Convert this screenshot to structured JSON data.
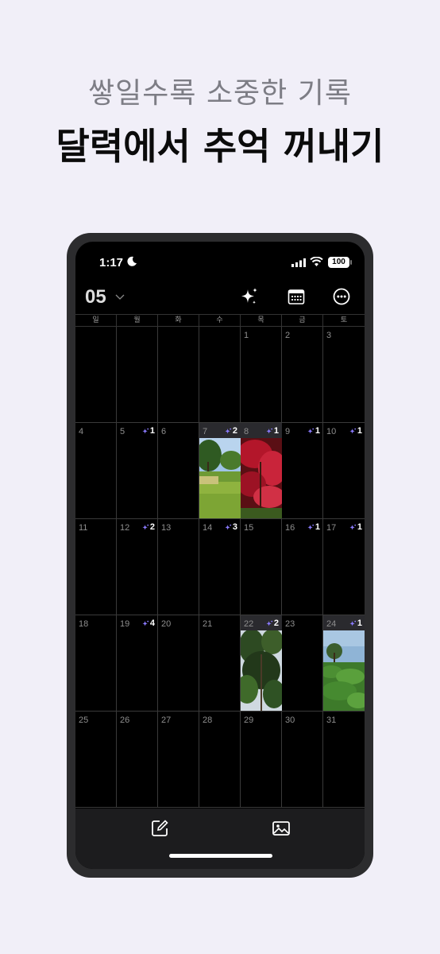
{
  "promo": {
    "subtitle": "쌓일수록 소중한 기록",
    "title": "달력에서 추억 꺼내기"
  },
  "status_bar": {
    "time": "1:17",
    "battery": "100"
  },
  "header": {
    "month": "05",
    "icons": [
      "sparkle-icon",
      "calendar-icon",
      "more-icon"
    ]
  },
  "weekdays": [
    "일",
    "월",
    "화",
    "수",
    "목",
    "금",
    "토"
  ],
  "accent_color": "#8b7bff",
  "weeks": [
    [
      {
        "day": ""
      },
      {
        "day": ""
      },
      {
        "day": ""
      },
      {
        "day": ""
      },
      {
        "day": "1"
      },
      {
        "day": "2"
      },
      {
        "day": "3"
      }
    ],
    [
      {
        "day": "4"
      },
      {
        "day": "5",
        "count": "1"
      },
      {
        "day": "6"
      },
      {
        "day": "7",
        "count": "2"
      },
      {
        "day": "8",
        "count": "1"
      },
      {
        "day": "9",
        "count": "1"
      },
      {
        "day": "10",
        "count": "1"
      }
    ],
    [
      {
        "day": "11"
      },
      {
        "day": "12",
        "count": "2"
      },
      {
        "day": "13"
      },
      {
        "day": "14",
        "count": "3"
      },
      {
        "day": "15"
      },
      {
        "day": "16",
        "count": "1"
      },
      {
        "day": "17",
        "count": "1"
      }
    ],
    [
      {
        "day": "18"
      },
      {
        "day": "19",
        "count": "4"
      },
      {
        "day": "20"
      },
      {
        "day": "21"
      },
      {
        "day": "22",
        "count": "2"
      },
      {
        "day": "23"
      },
      {
        "day": "24",
        "count": "1"
      }
    ],
    [
      {
        "day": "25"
      },
      {
        "day": "26"
      },
      {
        "day": "27"
      },
      {
        "day": "28"
      },
      {
        "day": "29"
      },
      {
        "day": "30"
      },
      {
        "day": "31"
      }
    ]
  ],
  "tab_bar": {
    "icons": [
      "compose-icon",
      "gallery-icon"
    ]
  }
}
